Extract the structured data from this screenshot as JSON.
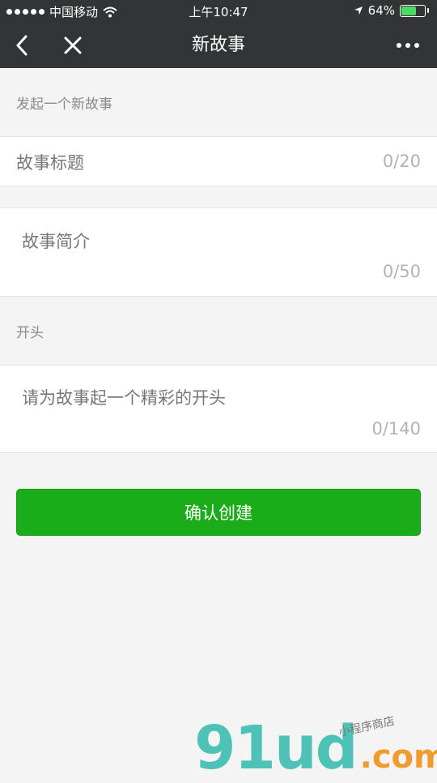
{
  "status_bar": {
    "carrier": "中国移动",
    "time": "上午10:47",
    "battery_percent": "64%",
    "battery_level": 0.64,
    "battery_color": "#4cd964"
  },
  "navbar": {
    "title": "新故事",
    "back_icon": "chevron-left-icon",
    "close_icon": "close-icon",
    "more_icon": "more-dots-icon"
  },
  "form": {
    "section_new_story": "发起一个新故事",
    "title_field": {
      "placeholder": "故事标题",
      "counter": "0/20"
    },
    "intro_field": {
      "placeholder": "故事简介",
      "counter": "0/50"
    },
    "section_opening": "开头",
    "opening_field": {
      "placeholder": "请为故事起一个精彩的开头",
      "counter": "0/140"
    },
    "submit_label": "确认创建"
  },
  "watermark": {
    "brand": "91ud",
    "domain": ".com",
    "tagline": "小程序商店"
  },
  "colors": {
    "bar_bg": "#333436",
    "primary_button": "#1aad19",
    "page_bg": "#f4f4f4"
  }
}
